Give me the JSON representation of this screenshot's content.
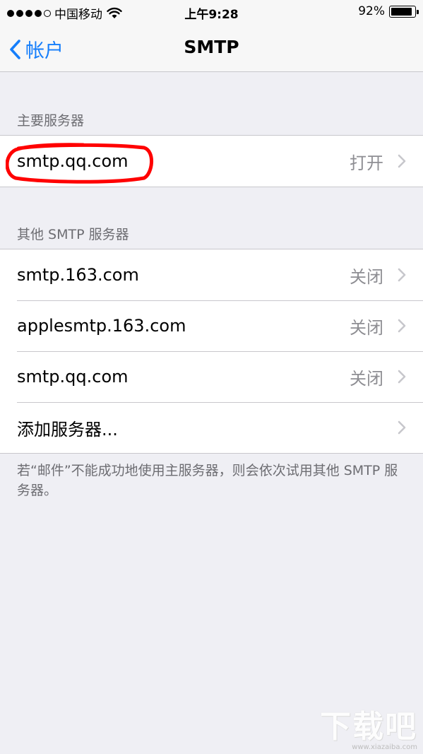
{
  "status_bar": {
    "carrier": "中国移动",
    "time": "上午9:28",
    "battery_percent": "92%",
    "battery_level": 0.92,
    "signal_bars": 4,
    "signal_total": 5
  },
  "nav": {
    "back_label": "帐户",
    "title": "SMTP"
  },
  "primary_section": {
    "header": "主要服务器",
    "rows": [
      {
        "title": "smtp.qq.com",
        "detail": "打开"
      }
    ]
  },
  "other_section": {
    "header": "其他 SMTP 服务器",
    "rows": [
      {
        "title": "smtp.163.com",
        "detail": "关闭"
      },
      {
        "title": "applesmtp.163.com",
        "detail": "关闭"
      },
      {
        "title": "smtp.qq.com",
        "detail": "关闭"
      },
      {
        "title": "添加服务器...",
        "detail": ""
      }
    ]
  },
  "footer_note": "若“邮件”不能成功地使用主服务器，则会依次试用其他 SMTP 服务器。",
  "colors": {
    "accent": "#157efb",
    "highlight_ring": "#ff0000",
    "secondary_text": "#8e8e93",
    "background": "#efeff4"
  },
  "watermark": {
    "brand": "下载吧",
    "url": "www.xiazaiba.com"
  }
}
